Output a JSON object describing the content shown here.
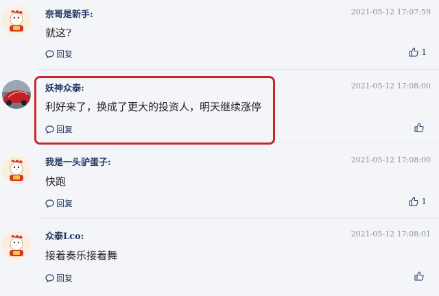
{
  "comments": [
    {
      "username": "奈哥是新手:",
      "timestamp": "2021-05-12 17:07:59",
      "text": "就这?",
      "reply_label": "回复",
      "like_count": "1",
      "avatar_icon": "rooster-cartoon-icon"
    },
    {
      "username": "妖神众泰:",
      "timestamp": "2021-05-12 17:08:00",
      "text": "利好来了，换成了更大的投资人，明天继续涨停",
      "reply_label": "回复",
      "like_count": "",
      "avatar_icon": "red-car-photo-icon"
    },
    {
      "username": "我是一头驴蛋子:",
      "timestamp": "2021-05-12 17:08:00",
      "text": "快跑",
      "reply_label": "回复",
      "like_count": "1",
      "avatar_icon": "rooster-cartoon-icon"
    },
    {
      "username": "众泰Lco:",
      "timestamp": "2021-05-12 17:08:01",
      "text": "接着奏乐接着舞",
      "reply_label": "回复",
      "like_count": "",
      "avatar_icon": "rooster-cartoon-icon"
    }
  ],
  "colors": {
    "highlight": "#c8252c",
    "username": "#233a63",
    "timestamp": "#8a8f99",
    "background": "#f4f5f9"
  }
}
